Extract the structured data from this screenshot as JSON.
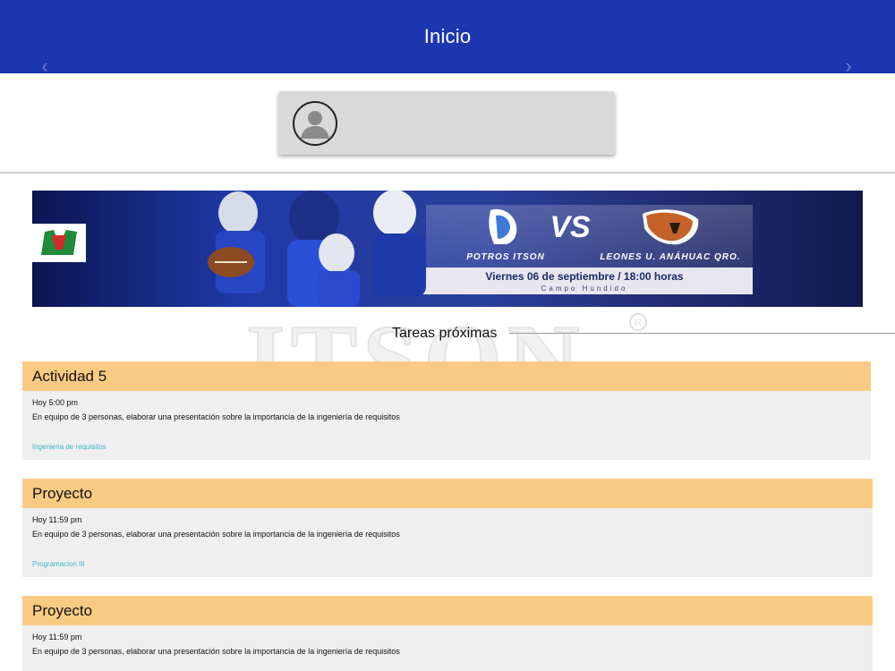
{
  "appbar": {
    "title": "Inicio"
  },
  "profile": {
    "avatar_icon": "user-avatar-icon"
  },
  "banner": {
    "team_home": "POTROS ITSON",
    "versus": "VS",
    "team_away": "LEONES U. ANÁHUAC QRO.",
    "date_text": "Viernes 06 de septiembre / 18:00 horas",
    "venue": "Campo Hundido",
    "league_logo_text": "onefa",
    "prev_icon": "chevron-left-icon",
    "next_icon": "chevron-right-icon"
  },
  "section": {
    "title": "Tareas próximas",
    "watermark": "ITSON"
  },
  "tasks": [
    {
      "title": "Actividad 5",
      "due": "Hoy 5:00 pm",
      "description": "En equipo de 3 personas, elaborar una presentación sobre la importancia de la ingeniería de requisitos",
      "course": "Ingenieria de requisitos"
    },
    {
      "title": "Proyecto",
      "due": "Hoy 11:59 pm",
      "description": "En equipo de 3 personas, elaborar una presentación sobre la importancia de la ingeniería de requisitos",
      "course": "Programacion III"
    },
    {
      "title": "Proyecto",
      "due": "Hoy 11:59 pm",
      "description": "En equipo de 3 personas, elaborar una presentación sobre la importancia de la ingeniería de requisitos",
      "course": ""
    }
  ],
  "colors": {
    "appbar": "#1c36b0",
    "task_header": "#f9cb82",
    "task_body": "#f0eff0",
    "course_link": "#3bb6c9"
  }
}
